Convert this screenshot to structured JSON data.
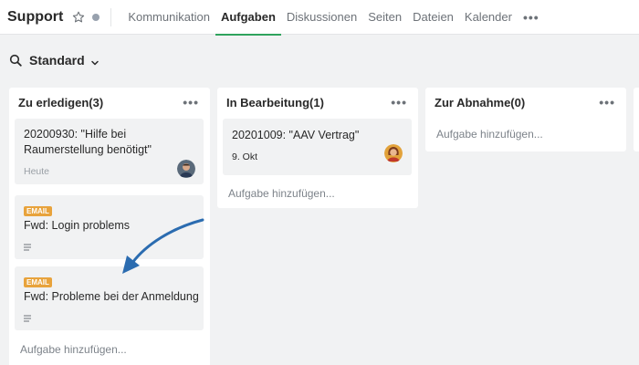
{
  "header": {
    "title": "Support",
    "tabs": [
      {
        "label": "Kommunikation",
        "active": false
      },
      {
        "label": "Aufgaben",
        "active": true
      },
      {
        "label": "Diskussionen",
        "active": false
      },
      {
        "label": "Seiten",
        "active": false
      },
      {
        "label": "Dateien",
        "active": false
      },
      {
        "label": "Kalender",
        "active": false
      }
    ],
    "accent_color": "#2fa35d"
  },
  "view": {
    "label": "Standard"
  },
  "columns": [
    {
      "title": "Zu erledigen(3)",
      "cards": [
        {
          "title": "20200930: \"Hilfe bei Raumerstellung benötigt\"",
          "meta": "Heute",
          "badge": "",
          "has_description": false,
          "avatar": "avatar-man"
        },
        {
          "title": "Fwd: Login problems",
          "meta": "",
          "badge": "EMAIL",
          "has_description": true,
          "avatar": ""
        },
        {
          "title": "Fwd: Probleme bei der Anmeldung",
          "meta": "",
          "badge": "EMAIL",
          "has_description": true,
          "avatar": ""
        }
      ],
      "add_label": "Aufgabe hinzufügen..."
    },
    {
      "title": "In Bearbeitung(1)",
      "cards": [
        {
          "title": "20201009: \"AAV Vertrag\"",
          "meta": "9. Okt",
          "badge": "",
          "has_description": false,
          "avatar": "avatar-woman"
        }
      ],
      "add_label": "Aufgabe hinzufügen..."
    },
    {
      "title": "Zur Abnahme(0)",
      "cards": [],
      "add_label": "Aufgabe hinzufügen..."
    }
  ],
  "annotation": {
    "arrow_color": "#2b6cb0"
  }
}
